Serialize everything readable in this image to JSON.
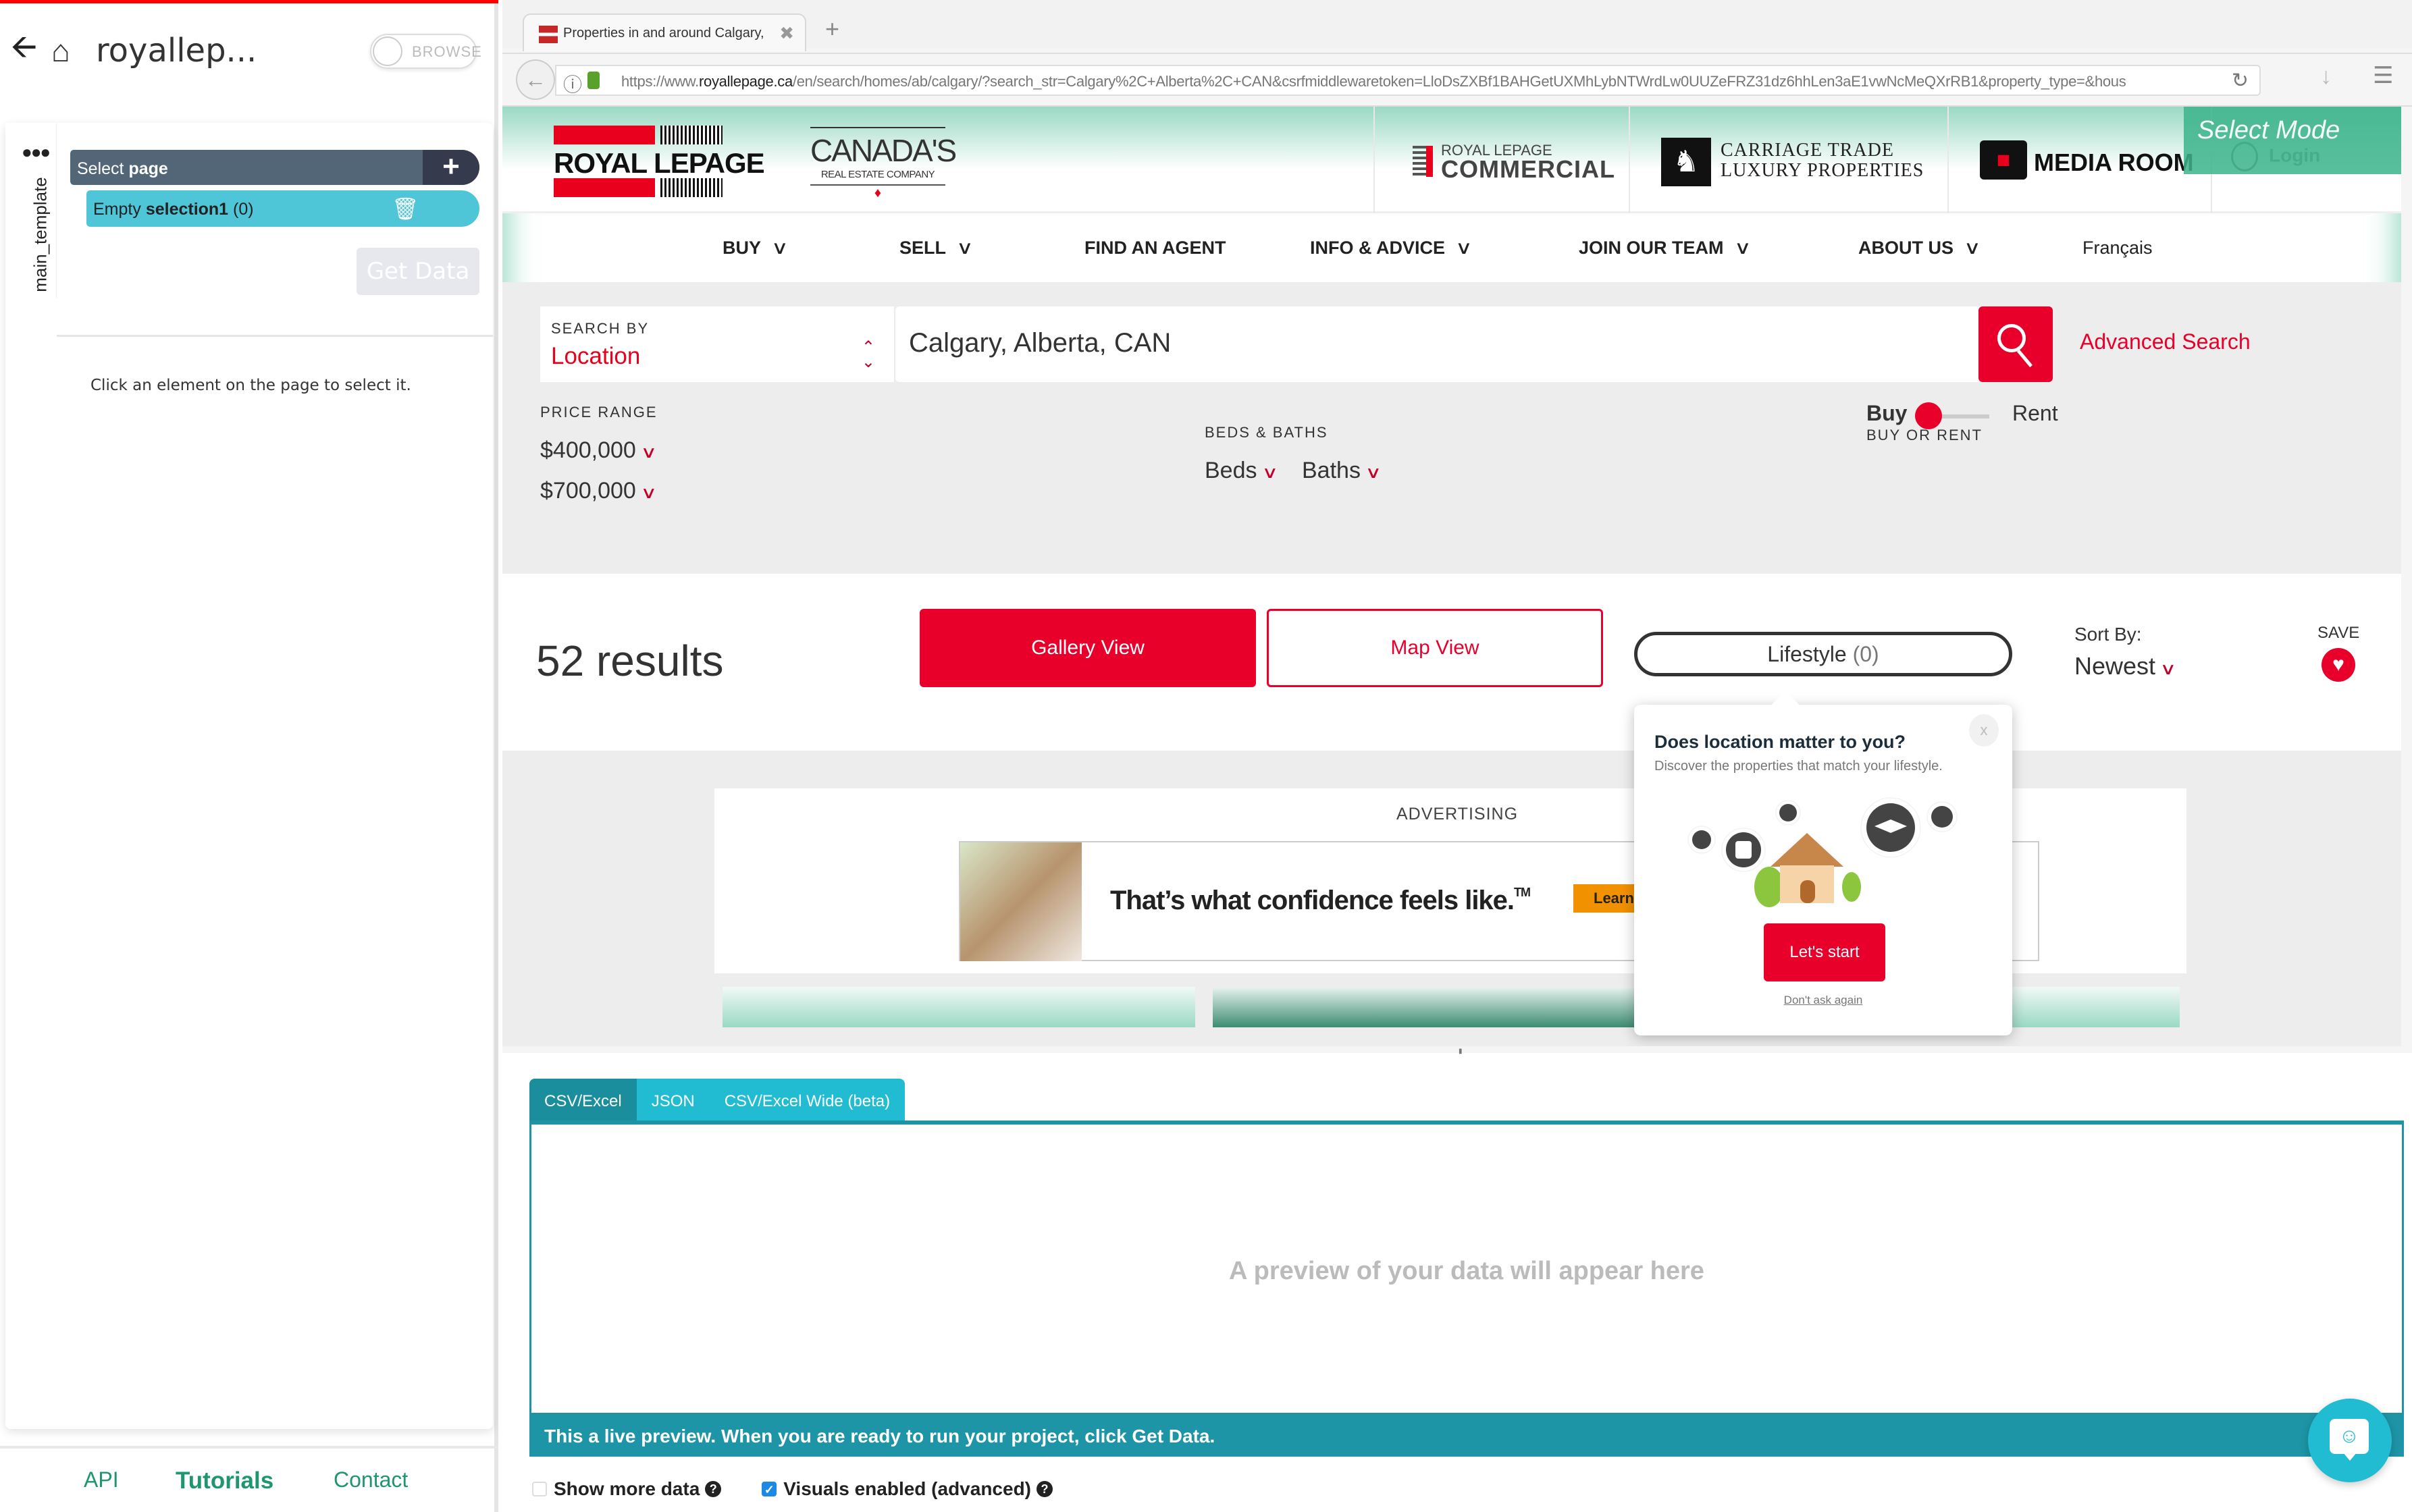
{
  "app": {
    "project_name": "royallep...",
    "browse_toggle_label": "BROWSE",
    "template_name": "main_template",
    "select_row": {
      "prefix": "Select",
      "target": "page"
    },
    "selection_row": {
      "prefix": "Empty",
      "name": "selection1",
      "count": "(0)"
    },
    "get_data_label": "Get Data",
    "hint": "Click an element on the page to select it.",
    "footer_links": [
      "API",
      "Tutorials",
      "Contact"
    ],
    "accent_color": "#1f9670"
  },
  "browser": {
    "tab_title": "Properties in and around Calgary,",
    "url_prefix": "https://www.",
    "url_domain": "royallepage.ca",
    "url_rest": "/en/search/homes/ab/calgary/?search_str=Calgary%2C+Alberta%2C+CAN&csrfmiddlewaretoken=LloDsZXBf1BAHGetUXMhLybNTWrdLw0UUZeFRZ31dz6hhLen3aE1vwNcMeQXrRB1&property_type=&hous"
  },
  "site": {
    "logo_text": "ROYAL LEPAGE",
    "tagline_big": "CANADA'S",
    "tagline_small": "REAL ESTATE COMPANY",
    "commercial": {
      "line1": "ROYAL LEPAGE",
      "line2": "COMMERCIAL"
    },
    "carriage": {
      "line1": "CARRIAGE TRADE",
      "line2": "LUXURY PROPERTIES"
    },
    "media_room": "MEDIA ROOM",
    "select_mode": "Select Mode",
    "login": "Login",
    "nav": [
      {
        "label": "BUY",
        "dropdown": true
      },
      {
        "label": "SELL",
        "dropdown": true
      },
      {
        "label": "FIND AN AGENT",
        "dropdown": false
      },
      {
        "label": "INFO & ADVICE",
        "dropdown": true
      },
      {
        "label": "JOIN OUR TEAM",
        "dropdown": true
      },
      {
        "label": "ABOUT US",
        "dropdown": true
      },
      {
        "label": "Français",
        "dropdown": false
      }
    ],
    "search": {
      "search_by_label": "SEARCH BY",
      "search_by_value": "Location",
      "query": "Calgary, Alberta, CAN",
      "advanced": "Advanced Search",
      "price_label": "PRICE RANGE",
      "price_min": "$400,000",
      "price_max": "$700,000",
      "beds_baths_label": "BEDS & BATHS",
      "beds": "Beds",
      "baths": "Baths",
      "buy_rent_label": "BUY OR RENT",
      "buy": "Buy",
      "rent": "Rent",
      "buy_rent_selected": "Buy"
    },
    "results": {
      "count_text": "52 results",
      "gallery_view": "Gallery View",
      "map_view": "Map View",
      "lifestyle": "Lifestyle",
      "lifestyle_count": "(0)",
      "sort_label": "Sort By:",
      "sort_value": "Newest",
      "save_label": "SAVE"
    },
    "ad": {
      "label": "ADVERTISING",
      "headline": "That’s what confidence feels like.",
      "tm": "TM",
      "cta": "Learn",
      "label2": "ADVERTISING"
    },
    "popover": {
      "title": "Does location matter to you?",
      "desc": "Discover the properties that match your lifestyle.",
      "close": "x",
      "cta": "Let's start",
      "dismiss": "Don't ask again"
    },
    "brand_color": "#e8002b"
  },
  "preview": {
    "tabs": [
      "CSV/Excel",
      "JSON",
      "CSV/Excel Wide (beta)"
    ],
    "active_tab": "CSV/Excel",
    "placeholder": "A preview of your data will appear here",
    "live_note": "This a live preview. When you are ready to run your project, click Get Data.",
    "options": [
      {
        "label": "Show more data",
        "checked": false
      },
      {
        "label": "Visuals enabled (advanced)",
        "checked": true
      }
    ]
  }
}
